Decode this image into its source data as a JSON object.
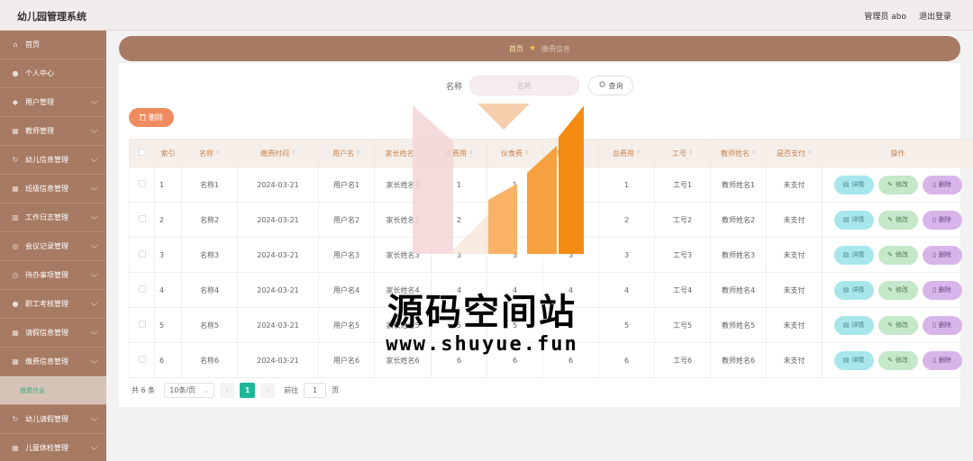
{
  "header": {
    "title": "幼儿园管理系统",
    "admin_label": "管理员 abo",
    "logout_label": "退出登录"
  },
  "sidebar": {
    "items": [
      {
        "label": "首页",
        "icon": "home-icon"
      },
      {
        "label": "个人中心",
        "icon": "user-icon"
      },
      {
        "label": "用户管理",
        "icon": "location-icon"
      },
      {
        "label": "教师管理",
        "icon": "grid-icon"
      },
      {
        "label": "幼儿信息管理",
        "icon": "refresh-icon"
      },
      {
        "label": "班级信息管理",
        "icon": "grid-icon"
      },
      {
        "label": "工作日志管理",
        "icon": "chart-icon"
      },
      {
        "label": "会议记录管理",
        "icon": "chat-icon"
      },
      {
        "label": "待办事项管理",
        "icon": "clock-icon"
      },
      {
        "label": "职工考核管理",
        "icon": "user-icon"
      },
      {
        "label": "请假信息管理",
        "icon": "grid-icon"
      },
      {
        "label": "缴费信息管理",
        "icon": "grid-icon"
      },
      {
        "label": "缴费信息",
        "icon": "",
        "sub": true
      },
      {
        "label": "幼儿请假管理",
        "icon": "refresh-icon"
      },
      {
        "label": "儿童体检管理",
        "icon": "grid-icon"
      }
    ]
  },
  "breadcrumb": {
    "home": "首页",
    "current": "缴费信息"
  },
  "search": {
    "label": "名称",
    "placeholder": "名称",
    "button": "查询"
  },
  "toolbar": {
    "delete_label": "删除"
  },
  "table": {
    "columns": [
      "索引",
      "名称",
      "缴费时间",
      "用户名",
      "家长姓名",
      "本费用",
      "伙食费",
      "教材费",
      "总费用",
      "工号",
      "教师姓名",
      "是否支付",
      "操作"
    ],
    "rows": [
      [
        "1",
        "名称1",
        "2024-03-21",
        "用户名1",
        "家长姓名1",
        "1",
        "1",
        "1",
        "1",
        "工号1",
        "教师姓名1",
        "未支付"
      ],
      [
        "2",
        "名称2",
        "2024-03-21",
        "用户名2",
        "家长姓名2",
        "2",
        "2",
        "2",
        "2",
        "工号2",
        "教师姓名2",
        "未支付"
      ],
      [
        "3",
        "名称3",
        "2024-03-21",
        "用户名3",
        "家长姓名3",
        "3",
        "3",
        "3",
        "3",
        "工号3",
        "教师姓名3",
        "未支付"
      ],
      [
        "4",
        "名称4",
        "2024-03-21",
        "用户名4",
        "家长姓名4",
        "4",
        "4",
        "4",
        "4",
        "工号4",
        "教师姓名4",
        "未支付"
      ],
      [
        "5",
        "名称5",
        "2024-03-21",
        "用户名5",
        "家长姓名5",
        "5",
        "5",
        "5",
        "5",
        "工号5",
        "教师姓名5",
        "未支付"
      ],
      [
        "6",
        "名称6",
        "2024-03-21",
        "用户名6",
        "家长姓名6",
        "6",
        "6",
        "6",
        "6",
        "工号6",
        "教师姓名6",
        "未支付"
      ]
    ],
    "actions": {
      "detail": "详情",
      "edit": "修改",
      "delete": "删除"
    }
  },
  "pagination": {
    "total": "共 6 条",
    "page_size": "10条/页",
    "current_page": "1",
    "goto_label": "前往",
    "goto_value": "1",
    "page_suffix": "页"
  },
  "watermark": {
    "title": "源码空间站",
    "url": "www.shuyue.fun"
  },
  "colors": {
    "sidebar": "#a77a63",
    "accent_orange": "#ef8b5e",
    "page_active": "#1fb79a"
  }
}
